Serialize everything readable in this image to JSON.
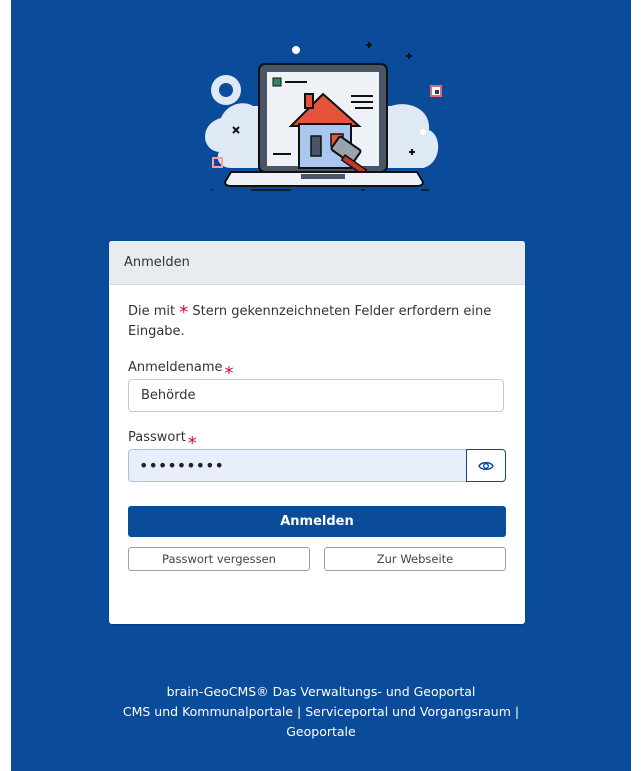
{
  "card": {
    "header_title": "Anmelden",
    "hint_before": "Die mit ",
    "hint_star": "*",
    "hint_after": " Stern gekennzeichneten Felder erfordern eine Eingabe."
  },
  "username": {
    "label": "Anmeldename",
    "star": "*",
    "value": "Behörde"
  },
  "password": {
    "label": "Passwort",
    "star": "*",
    "value": "•••••••••",
    "toggle_icon": "eye-icon"
  },
  "buttons": {
    "submit_label": "Anmelden",
    "forgot_label": "Passwort vergessen",
    "website_label": "Zur Webseite"
  },
  "footer": {
    "line1": "brain-GeoCMS® Das Verwaltungs- und Geoportal",
    "line2": "CMS und Kommunalportale | Serviceportal und Vorgangsraum |",
    "line3": "Geoportale"
  },
  "colors": {
    "brand_blue": "#0a4c9a",
    "required_star": "#c8102e",
    "header_bg": "#e9ecef",
    "password_bg": "#e8effa"
  }
}
